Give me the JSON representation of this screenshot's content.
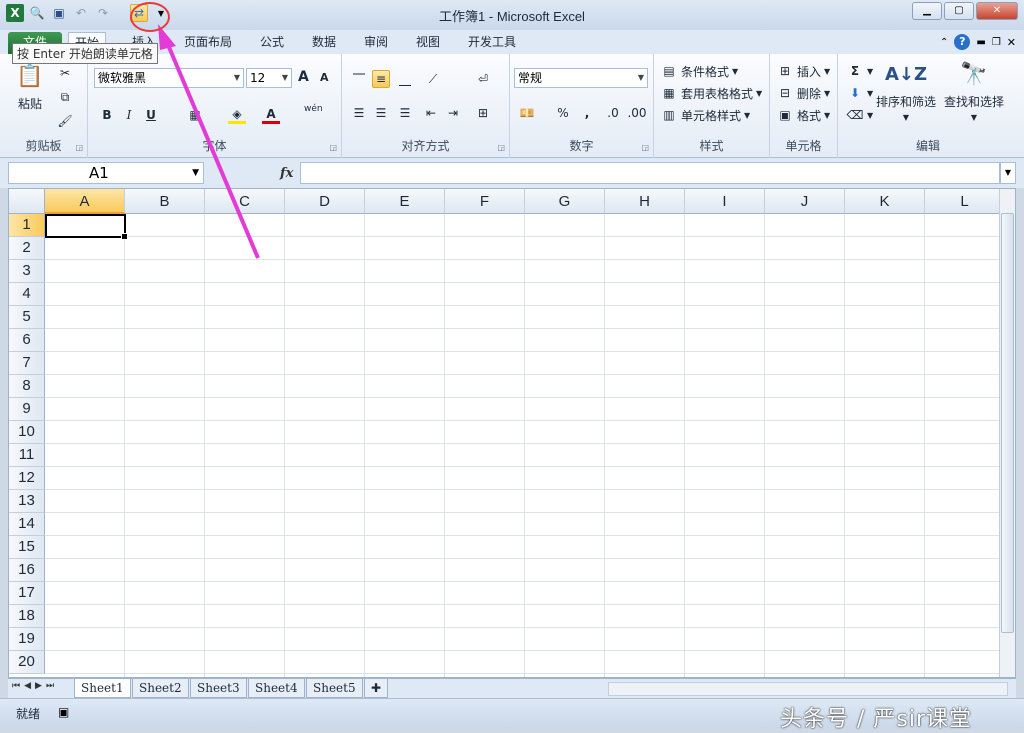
{
  "app": {
    "title": "工作簿1 - Microsoft Excel",
    "tooltip": "按 Enter 开始朗读单元格"
  },
  "tabs": [
    "文件",
    "开始",
    "插入",
    "页面布局",
    "公式",
    "数据",
    "审阅",
    "视图",
    "开发工具"
  ],
  "ribbon": {
    "clipboard": {
      "paste": "粘贴",
      "label": "剪贴板"
    },
    "font": {
      "name": "微软雅黑",
      "size": "12",
      "bold": "B",
      "italic": "I",
      "underline": "U",
      "label": "字体",
      "grow": "A",
      "shrink": "A",
      "phonetic": "wén"
    },
    "alignment": {
      "label": "对齐方式"
    },
    "number": {
      "format": "常规",
      "percent": "%",
      "comma": ",",
      "label": "数字"
    },
    "styles": {
      "conditional": "条件格式",
      "table": "套用表格格式",
      "cell": "单元格样式",
      "label": "样式"
    },
    "cells": {
      "insert": "插入",
      "delete": "删除",
      "format": "格式",
      "label": "单元格"
    },
    "editing": {
      "sum": "Σ",
      "sort": "排序和筛选",
      "find": "查找和选择",
      "label": "编辑"
    }
  },
  "formula_bar": {
    "name_box": "A1",
    "fx": "fx",
    "value": ""
  },
  "columns": [
    "A",
    "B",
    "C",
    "D",
    "E",
    "F",
    "G",
    "H",
    "I",
    "J",
    "K",
    "L"
  ],
  "rows": [
    "1",
    "2",
    "3",
    "4",
    "5",
    "6",
    "7",
    "8",
    "9",
    "10",
    "11",
    "12",
    "13",
    "14",
    "15",
    "16",
    "17",
    "18",
    "19",
    "20"
  ],
  "sheets": [
    "Sheet1",
    "Sheet2",
    "Sheet3",
    "Sheet4",
    "Sheet5"
  ],
  "status": {
    "ready": "就绪",
    "watermark": "头条号 / 严sir课堂"
  }
}
